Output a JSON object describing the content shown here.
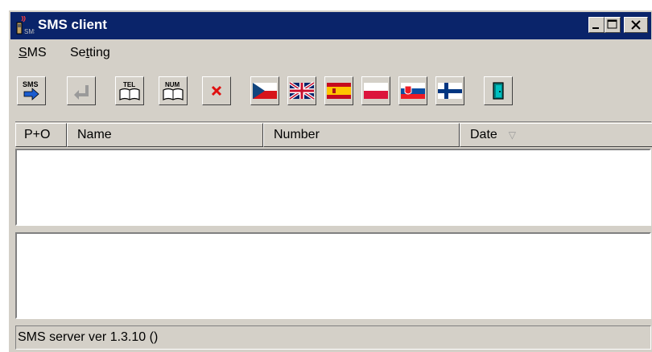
{
  "window": {
    "title": "SMS client"
  },
  "titlebar_buttons": {
    "minimize": "minimize-icon",
    "maximize": "maximize-icon",
    "close": "close-icon"
  },
  "menu": [
    {
      "label": "SMS",
      "accel": "S"
    },
    {
      "label": "Setting",
      "accel": "t"
    }
  ],
  "toolbar": {
    "send_icon_text": "SMS",
    "tel_book_text": "TEL",
    "num_book_text": "NUM",
    "flags": [
      "czech-flag-icon",
      "uk-flag-icon",
      "spain-flag-icon",
      "poland-flag-icon",
      "slovakia-flag-icon",
      "finland-flag-icon"
    ],
    "colors": {
      "czech_red": "#d7141a",
      "czech_blue": "#11457e",
      "uk_blue": "#012169",
      "uk_red": "#c8102e",
      "spain_red": "#c60b1e",
      "spain_yellow": "#ffc400",
      "finland_blue": "#003580",
      "exit_teal": "#008080"
    }
  },
  "columns": [
    {
      "label": "P+O"
    },
    {
      "label": "Name"
    },
    {
      "label": "Number"
    },
    {
      "label": "Date",
      "sort_indicator": "▽"
    }
  ],
  "status": {
    "text": "SMS server ver 1.3.10 ()"
  }
}
